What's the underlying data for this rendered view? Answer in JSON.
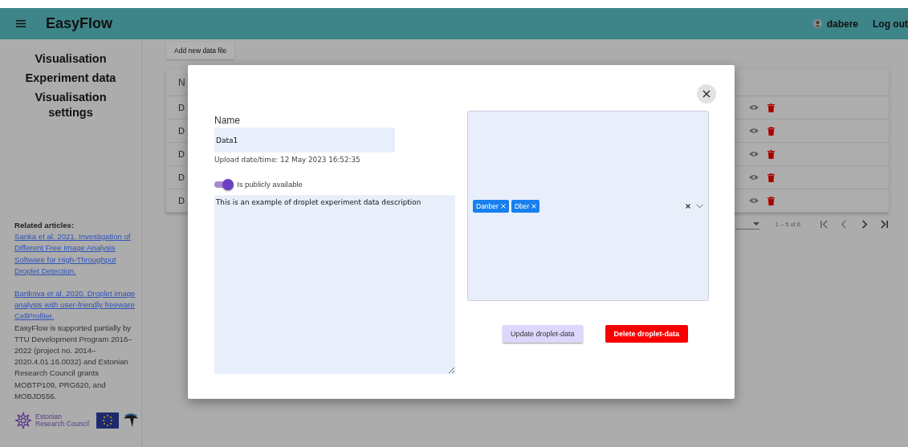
{
  "header": {
    "title": "EasyFlow",
    "user": "dabere",
    "logout": "Log out"
  },
  "sidebar": {
    "nav": [
      {
        "label": "Visualisation"
      },
      {
        "label": "Experiment data"
      },
      {
        "label": "Visualisation settings"
      }
    ],
    "related_label": "Related articles:",
    "articles": [
      "Sanka et al. 2021. Investigation of Different Free Image Analysis Software for High-Throughput Droplet Detection.",
      "Bartkova et al. 2020. Droplet image analysis with user-friendly freeware CellProfiler."
    ],
    "support": "EasyFlow is supported partially by TTU Development Program 2016–2022 (project no. 2014–2020.4.01.16.0032) and Estonian Research Council grants MOBTP109, PRG620, and MOBJD556.",
    "council_logo": "Estonian Research Council"
  },
  "add_button": "Add new data file",
  "table": {
    "header": "N",
    "rows": [
      "D",
      "D",
      "D",
      "D",
      "D"
    ],
    "pagination": "1 – 5 of 6"
  },
  "modal": {
    "name_label": "Name",
    "name_value": "Data1",
    "upload": "Upload date/time: 12 May 2023 16:52:35",
    "toggle": {
      "label": "Is publicly available",
      "on": true
    },
    "description": "This is an example of droplet experiment data description",
    "tags": [
      "Danber",
      "Dber"
    ],
    "buttons": [
      {
        "label": "Update droplet-data",
        "kind": "update"
      },
      {
        "label": "Delete droplet-data",
        "kind": "delete"
      }
    ]
  }
}
